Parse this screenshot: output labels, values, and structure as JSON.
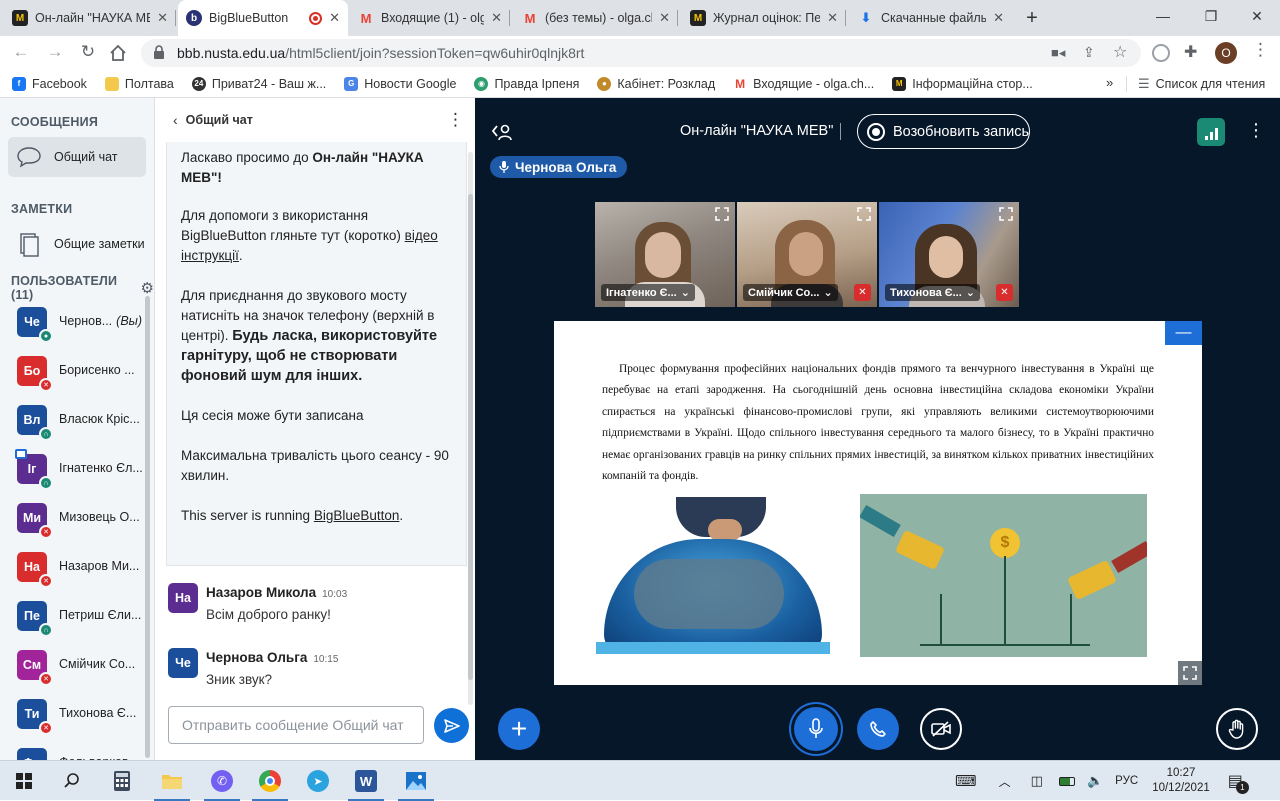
{
  "browser": {
    "tabs": [
      {
        "title": "Он-лайн \"НАУКА МЕВ\"",
        "favicon": "nauka-icon",
        "active": false
      },
      {
        "title": "BigBlueButton",
        "favicon": "bigbluebutton-icon",
        "active": true,
        "recording": true
      },
      {
        "title": "Входящие (1) - olga.ch",
        "favicon": "gmail-icon",
        "active": false
      },
      {
        "title": "(без темы) - olga.ch",
        "favicon": "gmail-icon",
        "active": false
      },
      {
        "title": "Журнал оцінок: Пе",
        "favicon": "nauka-icon",
        "active": false
      },
      {
        "title": "Скачанные файлы",
        "favicon": "download-icon",
        "active": false
      }
    ],
    "url_host": "bbb.nusta.edu.ua",
    "url_path": "/html5client/join?sessionToken=qw6uhir0qlnjk8rt",
    "profile_initial": "O",
    "bookmarks": [
      {
        "label": "Facebook",
        "icon": "facebook-icon",
        "color": "#1877f2"
      },
      {
        "label": "Полтава",
        "icon": "folder-icon",
        "color": "#f2c94c"
      },
      {
        "label": "Приват24 - Ваш ж...",
        "icon": "privat24-icon",
        "color": "#333333"
      },
      {
        "label": "Новости Google",
        "icon": "google-news-icon",
        "color": "#4a86e8"
      },
      {
        "label": "Правда Ірпеня",
        "icon": "pravda-icon",
        "color": "#2e9e6e"
      },
      {
        "label": "Кабінет: Розклад",
        "icon": "cabinet-icon",
        "color": "#c08a2a"
      },
      {
        "label": "Входящие - olga.ch...",
        "icon": "gmail-icon",
        "color": "#ea4335"
      },
      {
        "label": "Інформаційна стор...",
        "icon": "nauka-icon",
        "color": "#222222"
      }
    ],
    "more_bookmarks": "»",
    "reading_list": "Список для чтения"
  },
  "sidebar": {
    "messages_heading": "СООБЩЕНИЯ",
    "public_chat": "Общий чат",
    "notes_heading": "ЗАМЕТКИ",
    "shared_notes": "Общие заметки",
    "users_heading": "ПОЛЬЗОВАТЕЛИ (11)",
    "users": [
      {
        "initials": "Че",
        "name": "Чернов...",
        "suffix": "(Вы)",
        "color": "#1b4f9c",
        "status": "mic-on",
        "presenter": false
      },
      {
        "initials": "Бо",
        "name": "Борисенко ...",
        "suffix": "",
        "color": "#d92d2d",
        "status": "muted",
        "presenter": false
      },
      {
        "initials": "Вл",
        "name": "Власюк Кріс...",
        "suffix": "",
        "color": "#1b4f9c",
        "status": "listen",
        "presenter": false
      },
      {
        "initials": "Іг",
        "name": "Ігнатенко Єл...",
        "suffix": "",
        "color": "#5b2d91",
        "status": "listen",
        "presenter": true
      },
      {
        "initials": "Ми",
        "name": "Мизовець О...",
        "suffix": "",
        "color": "#5b2d91",
        "status": "muted",
        "presenter": false
      },
      {
        "initials": "На",
        "name": "Назаров Ми...",
        "suffix": "",
        "color": "#d92d2d",
        "status": "muted",
        "presenter": false
      },
      {
        "initials": "Пе",
        "name": "Петриш Єли...",
        "suffix": "",
        "color": "#1b4f9c",
        "status": "listen",
        "presenter": false
      },
      {
        "initials": "См",
        "name": "Смійчик Со...",
        "suffix": "",
        "color": "#a2249a",
        "status": "muted",
        "presenter": false
      },
      {
        "initials": "Ти",
        "name": "Тихонова Є...",
        "suffix": "",
        "color": "#1b4f9c",
        "status": "muted",
        "presenter": false
      },
      {
        "initials": "Фо",
        "name": "Фольварков...",
        "suffix": "",
        "color": "#1b4f9c",
        "status": "muted",
        "presenter": false
      }
    ]
  },
  "chat": {
    "header": "Общий чат",
    "welcome": {
      "p1a": "Ласкаво просимо до ",
      "p1b": "Он-лайн \"НАУКА МЕВ\"",
      "p1c": "!",
      "p2a": "Для допомоги з використання BigBlueButton гляньте тут (коротко) ",
      "p2link": "відео інструкції",
      "p2c": ".",
      "p3a": "Для приєднання до звукового мосту натисніть на значок телефону (верхній в центрі). ",
      "p3b": "Будь ласка, використовуйте гарнітуру, щоб не створювати фоновий шум для інших.",
      "p4": "Ця сесія може бути записана",
      "p5": "Максимальна тривалість цього сеансу - 90 хвилин.",
      "p6a": "This server is running ",
      "p6link": "BigBlueButton",
      "p6c": "."
    },
    "messages": [
      {
        "initials": "На",
        "color": "#5b2d91",
        "author": "Назаров Микола",
        "time": "10:03",
        "text": "Всім доброго ранку!"
      },
      {
        "initials": "Че",
        "color": "#1b4f9c",
        "author": "Чернова Ольга",
        "time": "10:15",
        "text": "Зник звук?"
      }
    ],
    "placeholder": "Отправить сообщение Общий чат"
  },
  "meeting": {
    "title": "Он-лайн \"НАУКА МЕВ\"",
    "record_label": "Возобновить запись",
    "talking": "Чернова Ольга",
    "cameras": [
      {
        "name": "Ігнатенко Є...",
        "muted": false
      },
      {
        "name": "Смійчик Со...",
        "muted": true
      },
      {
        "name": "Тихонова Є...",
        "muted": true
      }
    ],
    "slide_text": "Процес формування професійних національних фондів прямого та венчурного інвестування в Україні ще перебуває на етапі зародження. На сьогоднішній день основна інвестиційна складова економіки України спирається на українські фінансово-промислові групи, які управляють великими системоутворюючими підприємствами в Україні. Щодо спільного інвестування середнього та малого бізнесу, то в Україні практично немає організованих гравців на ринку спільних прямих інвестицій, за винятком кількох приватних інвестиційних компаній та фондів."
  },
  "taskbar": {
    "apps": [
      "windows-start-icon",
      "search-icon",
      "calculator-icon",
      "file-explorer-icon",
      "viber-icon",
      "chrome-icon",
      "telegram-icon",
      "word-icon",
      "photos-icon"
    ],
    "language": "РУС",
    "time": "10:27",
    "date": "10/12/2021",
    "notifications": "1"
  }
}
